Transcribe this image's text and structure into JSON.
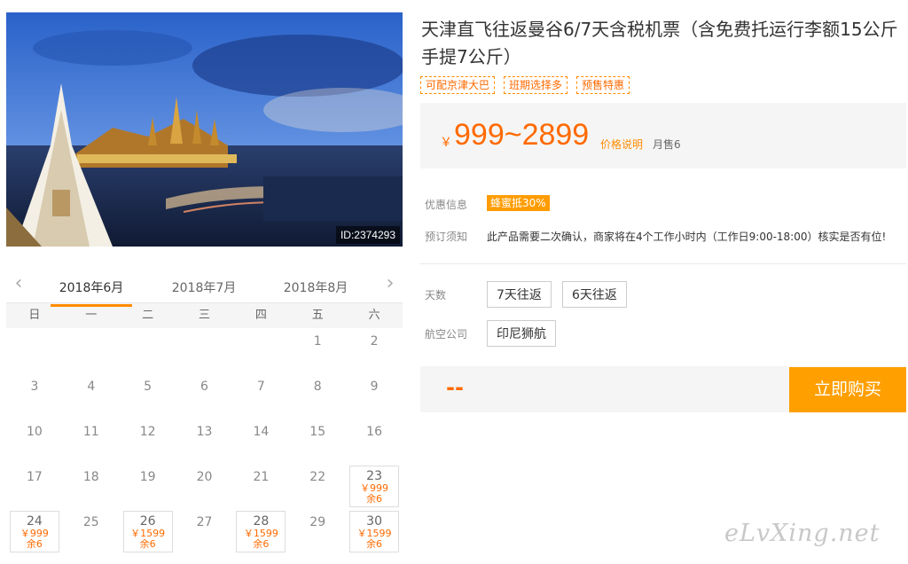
{
  "hero": {
    "image_id": "ID:2374293"
  },
  "calendar": {
    "months": [
      "2018年6月",
      "2018年7月",
      "2018年8月"
    ],
    "weekdays": [
      "日",
      "一",
      "二",
      "三",
      "四",
      "五",
      "六"
    ],
    "days": [
      {
        "d": ""
      },
      {
        "d": ""
      },
      {
        "d": ""
      },
      {
        "d": ""
      },
      {
        "d": ""
      },
      {
        "d": "1"
      },
      {
        "d": "2"
      },
      {
        "d": "3"
      },
      {
        "d": "4"
      },
      {
        "d": "5"
      },
      {
        "d": "6"
      },
      {
        "d": "7"
      },
      {
        "d": "8"
      },
      {
        "d": "9"
      },
      {
        "d": "10"
      },
      {
        "d": "11"
      },
      {
        "d": "12"
      },
      {
        "d": "13"
      },
      {
        "d": "14"
      },
      {
        "d": "15"
      },
      {
        "d": "16"
      },
      {
        "d": "17"
      },
      {
        "d": "18"
      },
      {
        "d": "19"
      },
      {
        "d": "20"
      },
      {
        "d": "21"
      },
      {
        "d": "22"
      },
      {
        "d": "23",
        "price": "￥999",
        "rem": "余6"
      },
      {
        "d": "24",
        "price": "￥999",
        "rem": "余6"
      },
      {
        "d": "25"
      },
      {
        "d": "26",
        "price": "￥1599",
        "rem": "余6"
      },
      {
        "d": "27"
      },
      {
        "d": "28",
        "price": "￥1599",
        "rem": "余6"
      },
      {
        "d": "29"
      },
      {
        "d": "30",
        "price": "￥1599",
        "rem": "余6"
      }
    ]
  },
  "product": {
    "title": "天津直飞往返曼谷6/7天含税机票（含免费托运行李额15公斤手提7公斤）",
    "tags": [
      "可配京津大巴",
      "班期选择多",
      "预售特惠"
    ],
    "currency": "￥",
    "price_range": "999~2899",
    "price_explain": "价格说明",
    "monthly_sales": "月售6",
    "promo_label": "优惠信息",
    "promo_value": "蜂蜜抵30%",
    "notice_label": "预订须知",
    "notice_value": "此产品需要二次确认，商家将在4个工作小时内（工作日9:00-18:00）核实是否有位!",
    "days_label": "天数",
    "days_options": [
      "7天往返",
      "6天往返"
    ],
    "airline_label": "航空公司",
    "airline_option": "印尼狮航",
    "total_placeholder": "--",
    "buy_label": "立即购买"
  },
  "watermark": "eLvXing.net",
  "colors": {
    "accent": "#ff8c00",
    "price": "#ff6a00",
    "buy_button": "#ff9f00"
  }
}
